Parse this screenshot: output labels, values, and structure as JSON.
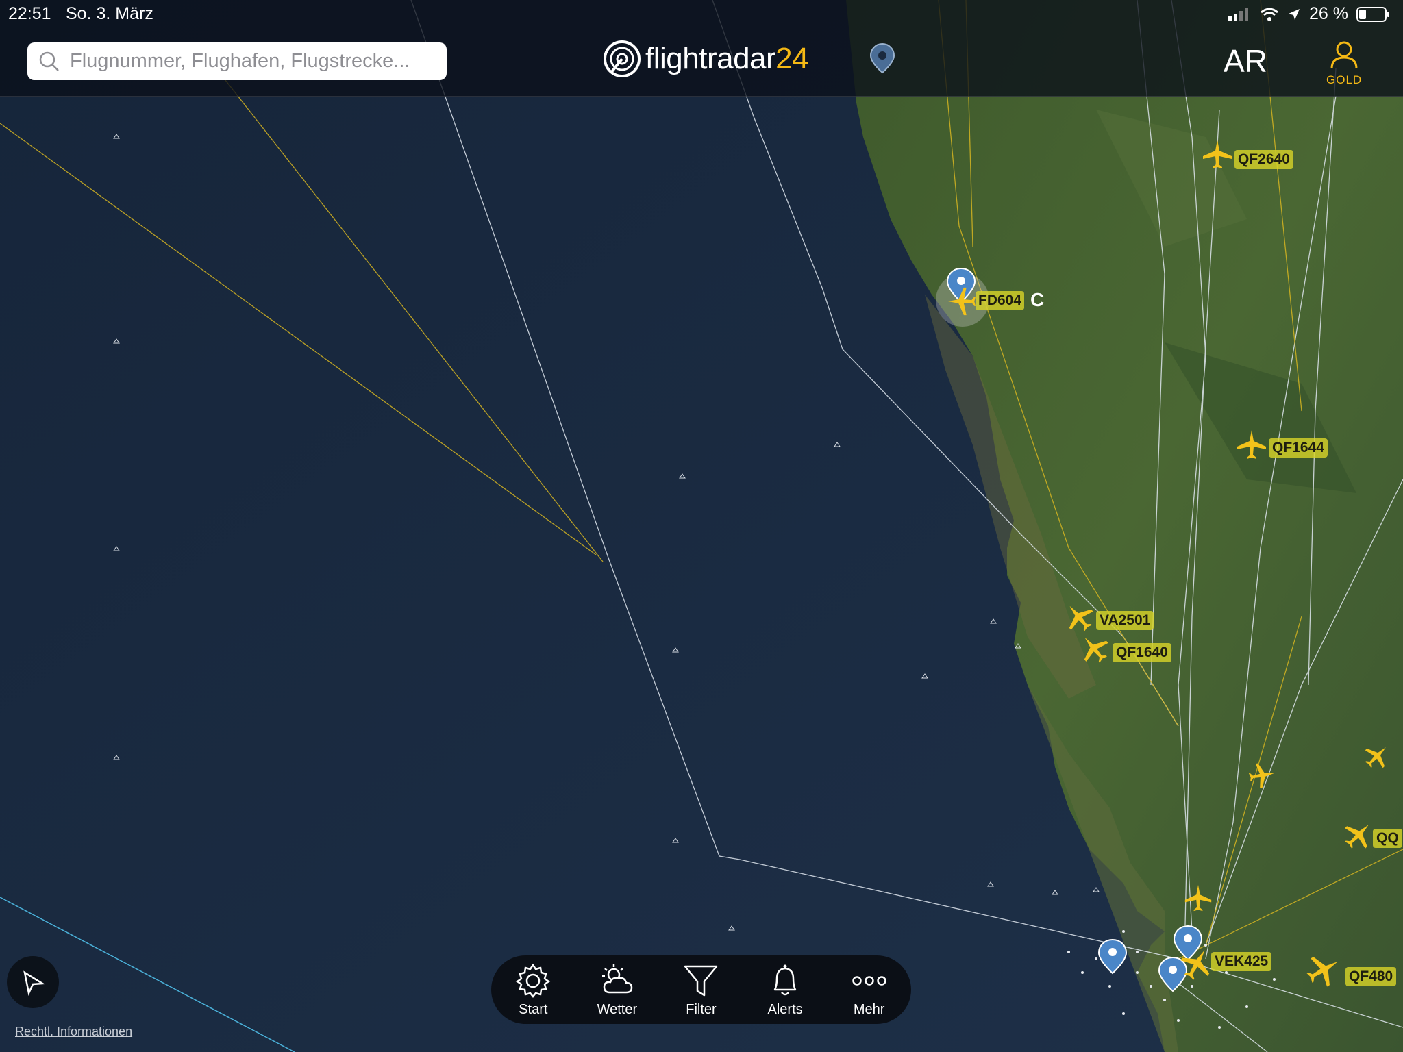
{
  "status_bar": {
    "time": "22:51",
    "date": "So. 3. März",
    "battery": "26 %"
  },
  "search": {
    "placeholder": "Flugnummer, Flughafen, Flugstrecke..."
  },
  "logo": {
    "part1": "flightradar",
    "part2": "24"
  },
  "header": {
    "ar_label": "AR",
    "gold_label": "GOLD"
  },
  "flights": [
    {
      "label": "QF2640"
    },
    {
      "label": "QF1644"
    },
    {
      "label": "VA2501"
    },
    {
      "label": "QF1640"
    },
    {
      "label": "VEK425"
    },
    {
      "label": "QF480"
    },
    {
      "label": "QQ"
    }
  ],
  "selected_flight": {
    "label": "FD604",
    "suffix": "C"
  },
  "tabbar": {
    "items": [
      {
        "label": "Start",
        "icon": "gear-icon"
      },
      {
        "label": "Wetter",
        "icon": "weather-icon"
      },
      {
        "label": "Filter",
        "icon": "filter-icon"
      },
      {
        "label": "Alerts",
        "icon": "bell-icon"
      },
      {
        "label": "Mehr",
        "icon": "more-icon"
      }
    ]
  },
  "legal": "Rechtl. Informationen",
  "colors": {
    "ocean": "#1b2a3e",
    "land": "#3d5a2a",
    "accent": "#f5b915",
    "label_bg": "#d6d228"
  }
}
